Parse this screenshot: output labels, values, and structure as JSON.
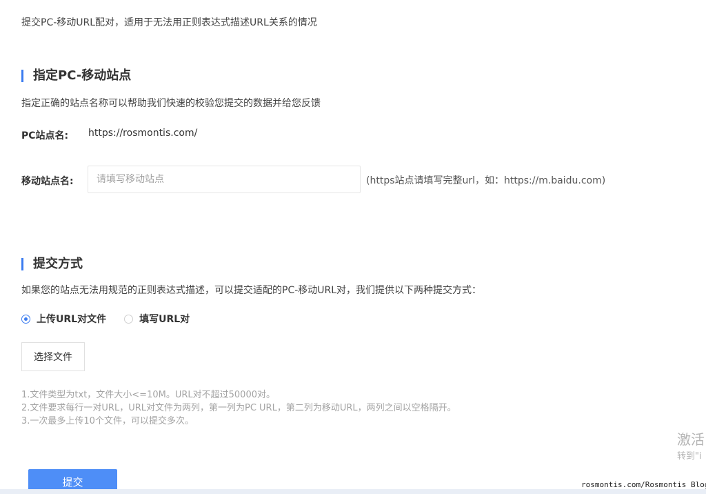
{
  "intro": "提交PC-移动URL配对，适用于无法用正则表达式描述URL关系的情况",
  "site_section": {
    "title": "指定PC-移动站点",
    "description": "指定正确的站点名称可以帮助我们快速的校验您提交的数据并给您反馈",
    "pc_label": "PC站点名:",
    "pc_value": "https://rosmontis.com/",
    "mobile_label": "移动站点名:",
    "mobile_placeholder": "请填写移动站点",
    "mobile_value": "",
    "hint": "(https站点请填写完整url，如：https://m.baidu.com)"
  },
  "submit_section": {
    "title": "提交方式",
    "description": "如果您的站点无法用规范的正则表达式描述，可以提交适配的PC-移动URL对，我们提供以下两种提交方式：",
    "options": [
      {
        "label": "上传URL对文件",
        "selected": true
      },
      {
        "label": "填写URL对",
        "selected": false
      }
    ],
    "file_button": "选择文件",
    "notes": [
      "1.文件类型为txt，文件大小<=10M。URL对不超过50000对。",
      "2.文件要求每行一对URL，URL对文件为两列，第一列为PC URL，第二列为移动URL，两列之间以空格隔开。",
      "3.一次最多上传10个文件，可以提交多次。"
    ],
    "submit_button": "提交"
  },
  "overlay": {
    "activate_text": "激活",
    "goto_text": "转到\"i",
    "site_watermark": "rosmontis.com/Rosmontis Blog"
  },
  "colors": {
    "accent": "#3b7cf0",
    "submit_button": "#4e8ef7",
    "note_text": "#a3a3a3"
  },
  "icons": {
    "radio_selected": "radio-checked-icon",
    "radio_unselected": "radio-unchecked-icon"
  }
}
